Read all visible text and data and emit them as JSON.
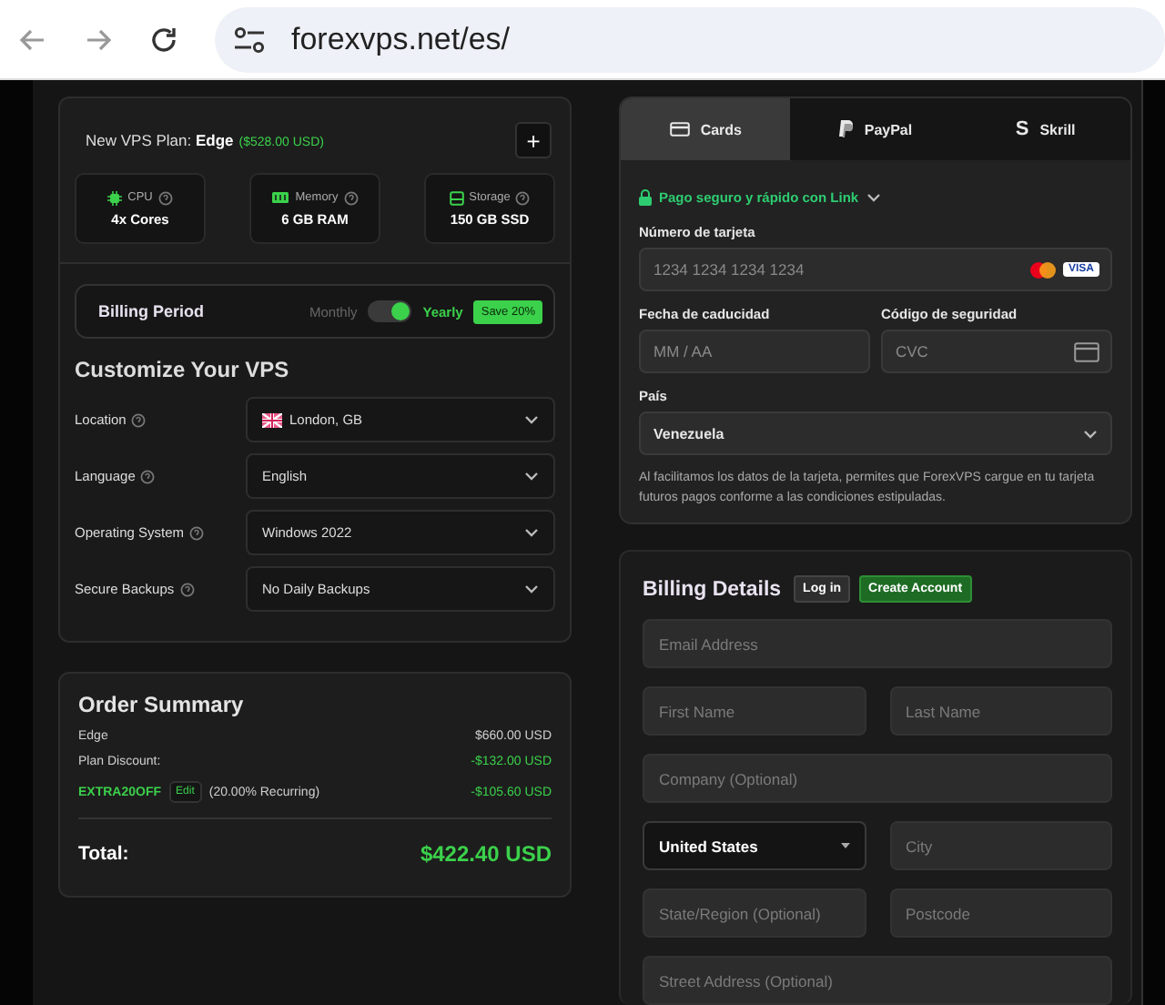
{
  "browser": {
    "url": "forexvps.net/es/"
  },
  "plan": {
    "label": "New VPS Plan:",
    "name": "Edge",
    "price": "($528.00 USD)",
    "add_button": "+",
    "specs": [
      {
        "kind": "cpu",
        "label": "CPU",
        "value": "4x Cores"
      },
      {
        "kind": "memory",
        "label": "Memory",
        "value": "6 GB RAM"
      },
      {
        "kind": "storage",
        "label": "Storage",
        "value": "150 GB SSD"
      }
    ],
    "billing_period": {
      "label": "Billing Period",
      "options": [
        {
          "label": "Monthly",
          "selected": false
        },
        {
          "label": "Yearly",
          "selected": true
        }
      ],
      "badge": "Save 20%"
    }
  },
  "customize": {
    "title": "Customize Your VPS",
    "options": [
      {
        "kind": "flag-select",
        "label": "Location",
        "value": "London, GB"
      },
      {
        "kind": "select",
        "label": "Language",
        "value": "English"
      },
      {
        "kind": "select",
        "label": "Operating System",
        "value": "Windows 2022"
      },
      {
        "kind": "select",
        "label": "Secure Backups",
        "value": "No Daily Backups"
      }
    ]
  },
  "order_summary": {
    "title": "Order Summary",
    "lines": [
      {
        "kind": "item",
        "label": "Edge",
        "amount": "$660.00 USD"
      },
      {
        "kind": "discount",
        "label": "Plan Discount:",
        "amount": "-$132.00 USD"
      },
      {
        "kind": "coupon",
        "label": "EXTRA20OFF",
        "edit": "Edit",
        "note": "(20.00% Recurring)",
        "amount": "-$105.60 USD"
      }
    ],
    "total_label": "Total:",
    "total": "$422.40 USD"
  },
  "payment": {
    "tabs": [
      {
        "kind": "card",
        "label": "Cards",
        "selected": true
      },
      {
        "kind": "paypal",
        "label": "PayPal",
        "selected": false
      },
      {
        "kind": "skrill",
        "label": "Skrill",
        "logo": "S",
        "selected": false
      }
    ],
    "link": "Pago seguro y rápido con Link",
    "card_number": {
      "label": "Número de tarjeta",
      "placeholder": "1234 1234 1234 1234",
      "brand_badge": "VISA"
    },
    "expiry": {
      "label": "Fecha de caducidad",
      "placeholder": "MM / AA"
    },
    "cvc": {
      "label": "Código de seguridad",
      "placeholder": "CVC"
    },
    "country": {
      "label": "País",
      "value": "Venezuela"
    },
    "note": "Al facilitamos los datos de la tarjeta, permites que ForexVPS cargue en tu tarjeta futuros pagos conforme a las condiciones estipuladas."
  },
  "billing": {
    "title": "Billing Details",
    "buttons": [
      {
        "kind": "secondary",
        "label": "Log in"
      },
      {
        "kind": "primary",
        "label": "Create Account"
      }
    ],
    "fields": [
      {
        "kind": "full",
        "placeholder": "Email Address"
      },
      {
        "kind": "half",
        "placeholder": "First Name"
      },
      {
        "kind": "half",
        "placeholder": "Last Name"
      },
      {
        "kind": "full",
        "placeholder": "Company (Optional)"
      },
      {
        "kind": "select",
        "value": "United States"
      },
      {
        "kind": "half",
        "placeholder": "City"
      },
      {
        "kind": "half",
        "placeholder": "State/Region (Optional)"
      },
      {
        "kind": "half",
        "placeholder": "Postcode"
      },
      {
        "kind": "full",
        "placeholder": "Street Address (Optional)"
      }
    ]
  }
}
